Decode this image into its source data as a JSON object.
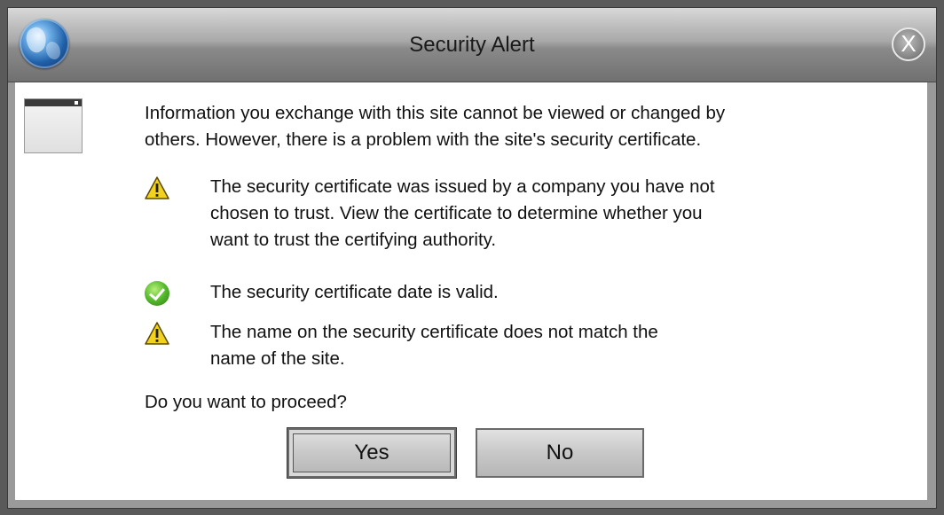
{
  "window": {
    "title": "Security Alert",
    "close_label": "X"
  },
  "dialog": {
    "intro_line1": "Information you exchange with this site cannot be viewed or changed by",
    "intro_line2": "others. However, there is a problem with the site's security certificate.",
    "items": [
      {
        "status": "warning",
        "icon": "warning-icon",
        "lines": [
          "The security certificate was issued by a company you have not",
          "chosen to trust. View the certificate to determine whether you",
          "want to trust the certifying authority."
        ]
      },
      {
        "status": "ok",
        "icon": "check-icon",
        "lines": [
          "The security certificate date is valid."
        ]
      },
      {
        "status": "warning",
        "icon": "warning-icon",
        "lines": [
          "The name on the security certificate does not match the",
          "name of the site."
        ]
      }
    ],
    "question": "Do you want to proceed?",
    "yes_label": "Yes",
    "no_label": "No"
  },
  "colors": {
    "warning": "#f2d21b",
    "ok": "#4caf2a",
    "titlebar": "#8a8a8a"
  }
}
